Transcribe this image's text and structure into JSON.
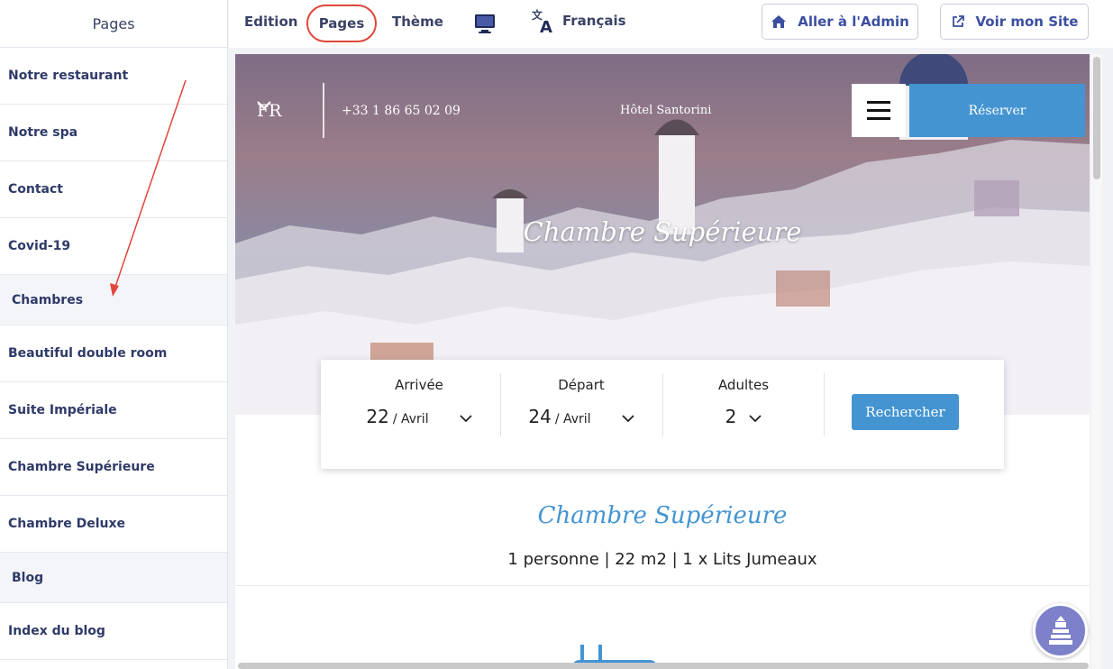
{
  "sidebar": {
    "title": "Pages",
    "items": [
      {
        "label": "Notre restaurant",
        "type": "item"
      },
      {
        "label": "Notre spa",
        "type": "item"
      },
      {
        "label": "Contact",
        "type": "item"
      },
      {
        "label": "Covid-19",
        "type": "item"
      },
      {
        "label": "Chambres",
        "type": "section"
      },
      {
        "label": "Beautiful double room",
        "type": "item"
      },
      {
        "label": "Suite Impériale",
        "type": "item"
      },
      {
        "label": "Chambre Supérieure",
        "type": "item"
      },
      {
        "label": "Chambre Deluxe",
        "type": "item"
      },
      {
        "label": "Blog",
        "type": "section"
      },
      {
        "label": "Index du blog",
        "type": "item"
      }
    ]
  },
  "topbar": {
    "tabs": {
      "edition": "Edition",
      "pages": "Pages",
      "theme": "Thème"
    },
    "language": "Français",
    "admin_button": "Aller à l'Admin",
    "site_button": "Voir mon Site",
    "icons": {
      "desktop": "desktop-monitor-icon",
      "translate": "translate-icon",
      "home": "home-icon",
      "external": "external-link-icon"
    }
  },
  "preview": {
    "lang": "FR",
    "phone": "+33 1 86 65 02 09",
    "hotel_name": "Hôtel Santorini",
    "reserve_label": "Réserver",
    "hero_title": "Chambre Supérieure",
    "booking": {
      "arrival_label": "Arrivée",
      "arrival_day": "22",
      "arrival_month": "/ Avril",
      "departure_label": "Départ",
      "departure_day": "24",
      "departure_month": "/ Avril",
      "adults_label": "Adultes",
      "adults_value": "2",
      "search_label": "Rechercher"
    },
    "room_title": "Chambre Supérieure",
    "room_info": "1 personne  |  22 m2  |  1 x Lits Jumeaux"
  },
  "colors": {
    "accent": "#4494d2",
    "nav_text": "#2f3a68",
    "highlight_circle": "#e0463b",
    "help_button": "#7c81c9"
  }
}
